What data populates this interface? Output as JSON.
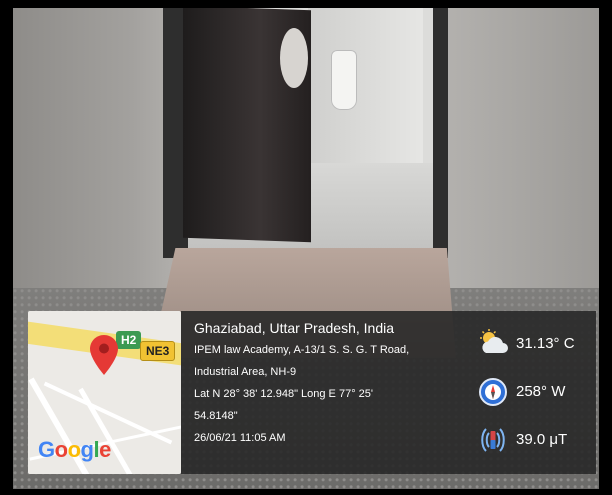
{
  "location": {
    "title": "Ghaziabad, Uttar Pradesh, India",
    "lines": [
      "IPEM law Academy, A-13/1 S. S. G. T Road,",
      "Industrial Area, NH-9",
      "Lat N 28° 38' 12.948\" Long E 77° 25'",
      "54.8148\"",
      "26/06/21 11:05 AM"
    ]
  },
  "map": {
    "shields": [
      "H2",
      "NE3"
    ],
    "logo_letters": [
      "G",
      "o",
      "o",
      "g",
      "l",
      "e"
    ],
    "icons": [
      "map-pin-icon"
    ]
  },
  "stats": [
    {
      "icon": "weather-partly-cloudy-icon",
      "value": "31.13° C"
    },
    {
      "icon": "compass-icon",
      "value": "258° W"
    },
    {
      "icon": "magnetic-field-icon",
      "value": "39.0 μT"
    }
  ],
  "colors": {
    "pin": "#e53935",
    "overlay_bg": "#262626",
    "shield_green": "#3c9a52",
    "shield_yellow": "#f1c232"
  }
}
